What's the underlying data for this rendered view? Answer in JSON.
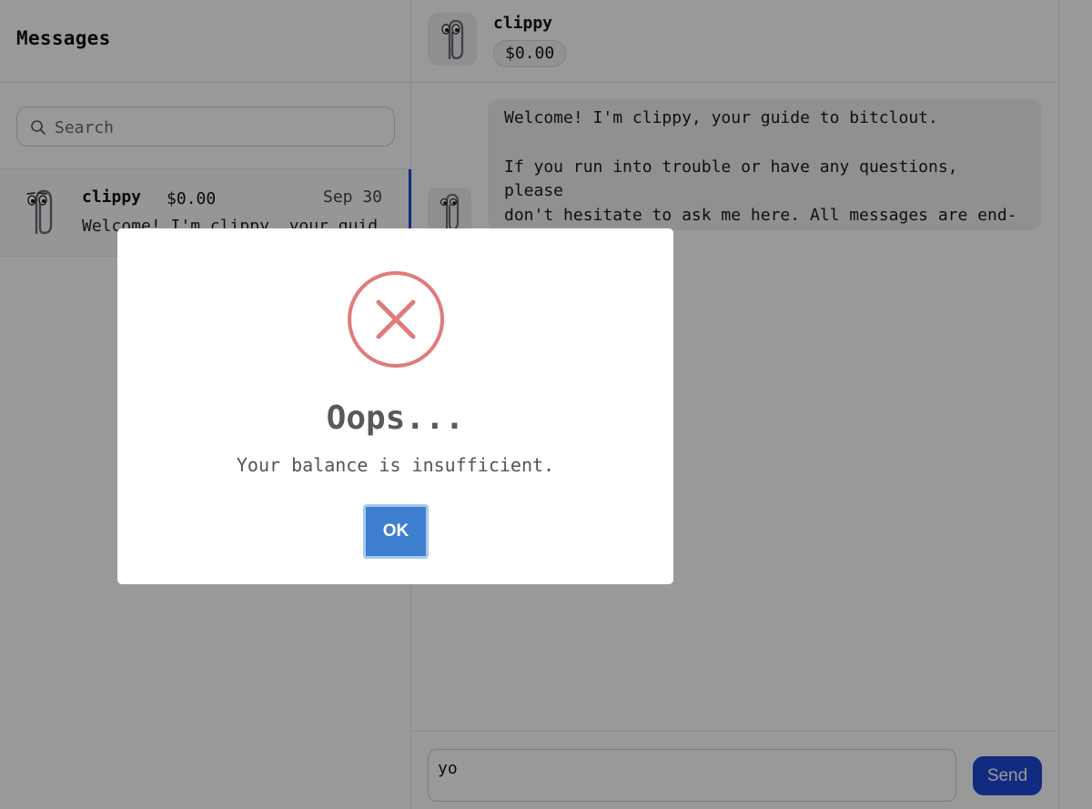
{
  "sidebar": {
    "title": "Messages",
    "search": {
      "placeholder": "Search",
      "value": ""
    },
    "conversations": [
      {
        "name": "clippy",
        "balance": "$0.00",
        "date": "Sep 30",
        "preview": "Welcome! I'm clippy, your guid"
      }
    ]
  },
  "chat": {
    "header": {
      "name": "clippy",
      "balance": "$0.00"
    },
    "messages": [
      {
        "text": "Welcome! I'm clippy, your guide to bitclout.\n\nIf you run into trouble or have any questions, please\ndon't hesitate to ask me here. All messages are end-\nto-end encrypted."
      }
    ],
    "composer": {
      "value": "yo",
      "send_label": "Send"
    }
  },
  "modal": {
    "icon": "error-x-icon",
    "title": "Oops...",
    "text": "Your balance is insufficient.",
    "ok_label": "OK"
  },
  "colors": {
    "accent": "#1f48d6",
    "ok_button": "#3f7fd0",
    "error": "#e07b7b"
  }
}
